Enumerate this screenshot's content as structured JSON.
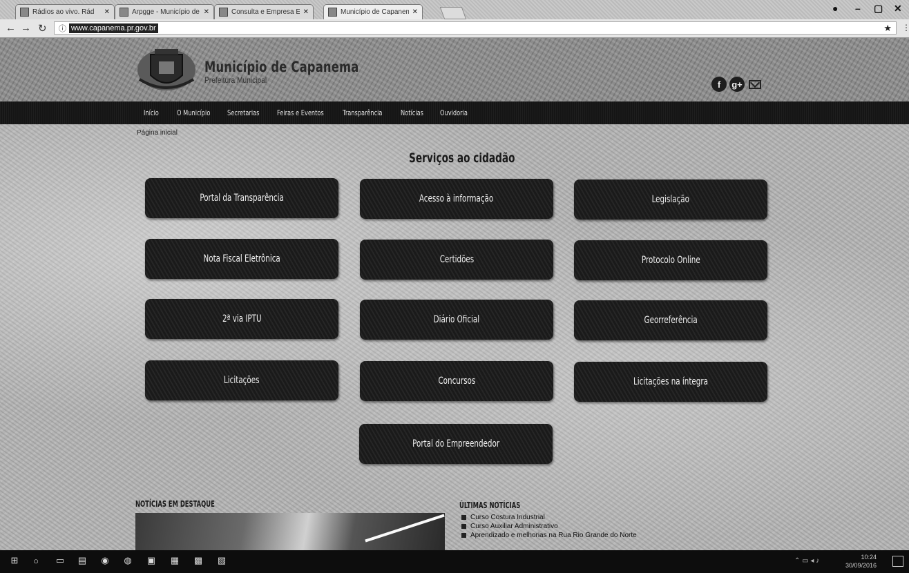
{
  "browser": {
    "tabs": [
      {
        "title": "Rádios ao vivo. Rád",
        "active": false
      },
      {
        "title": "Arpgge - Município de C",
        "active": false
      },
      {
        "title": "Consulta e Empresa Ele",
        "active": false
      },
      {
        "title": "Município de Capanema",
        "active": true
      }
    ],
    "url": "www.capanema.pr.gov.br"
  },
  "site": {
    "title": "Município de Capanema",
    "subtitle": "Prefeitura Municipal",
    "social": {
      "facebook": "f",
      "googleplus": "g+"
    }
  },
  "nav": {
    "items": [
      "Início",
      "O Município",
      "Secretarias",
      "Feiras e Eventos",
      "Transparência",
      "Notícias",
      "Ouvidoria"
    ]
  },
  "breadcrumb": "Página inicial",
  "services": {
    "title": "Serviços ao cidadão",
    "buttons": [
      "Portal da Transparência",
      "Acesso à informação",
      "Legislação",
      "Nota Fiscal Eletrônica",
      "Certidões",
      "Protocolo Online",
      "2ª via IPTU",
      "Diário Oficial",
      "Georreferência",
      "Licitações",
      "Concursos",
      "Licitações na íntegra",
      "Portal do Empreendedor"
    ]
  },
  "news": {
    "featured_heading": "NOTÍCIAS EM DESTAQUE",
    "latest_heading": "ÚLTIMAS NOTÍCIAS",
    "latest": [
      "Curso Costura Industrial",
      "Curso Auxiliar Administrativo",
      "Aprendizado e melhorias na Rua Rio Grande do Norte"
    ]
  },
  "taskbar": {
    "time": "10:24",
    "date": "30/09/2016"
  }
}
